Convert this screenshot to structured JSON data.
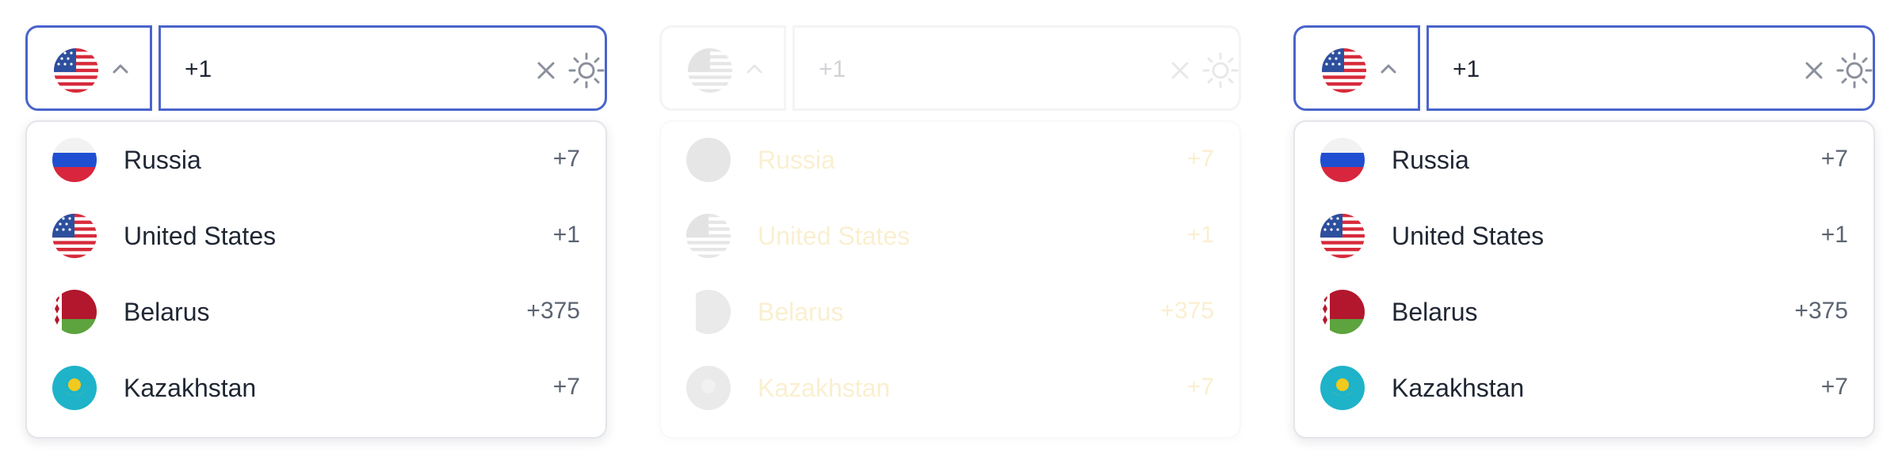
{
  "widgets": [
    {
      "state": "open",
      "selected_flag": "us-flag-icon",
      "phone": {
        "value": "+1"
      },
      "countries": [
        {
          "name": "Russia",
          "code": "+7",
          "flag": "russia-flag-icon"
        },
        {
          "name": "United States",
          "code": "+1",
          "flag": "us-flag-icon"
        },
        {
          "name": "Belarus",
          "code": "+375",
          "flag": "belarus-flag-icon"
        },
        {
          "name": "Kazakhstan",
          "code": "+7",
          "flag": "kazakhstan-flag-icon"
        }
      ]
    },
    {
      "state": "faded",
      "selected_flag": "us-flag-icon",
      "phone": {
        "value": "+1"
      },
      "countries": [
        {
          "name": "Russia",
          "code": "+7",
          "flag": "russia-flag-icon"
        },
        {
          "name": "United States",
          "code": "+1",
          "flag": "us-flag-icon"
        },
        {
          "name": "Belarus",
          "code": "+375",
          "flag": "belarus-flag-icon"
        },
        {
          "name": "Kazakhstan",
          "code": "+7",
          "flag": "kazakhstan-flag-icon"
        }
      ]
    },
    {
      "state": "open",
      "selected_flag": "us-flag-icon",
      "phone": {
        "value": "+1"
      },
      "countries": [
        {
          "name": "Russia",
          "code": "+7",
          "flag": "russia-flag-icon"
        },
        {
          "name": "United States",
          "code": "+1",
          "flag": "us-flag-icon"
        },
        {
          "name": "Belarus",
          "code": "+375",
          "flag": "belarus-flag-icon"
        },
        {
          "name": "Kazakhstan",
          "code": "+7",
          "flag": "kazakhstan-flag-icon"
        }
      ]
    }
  ],
  "colors": {
    "accent_border": "#4a64cc",
    "text": "#1f2633",
    "code_text": "#5b6472",
    "faded_text": "#e7b515"
  }
}
